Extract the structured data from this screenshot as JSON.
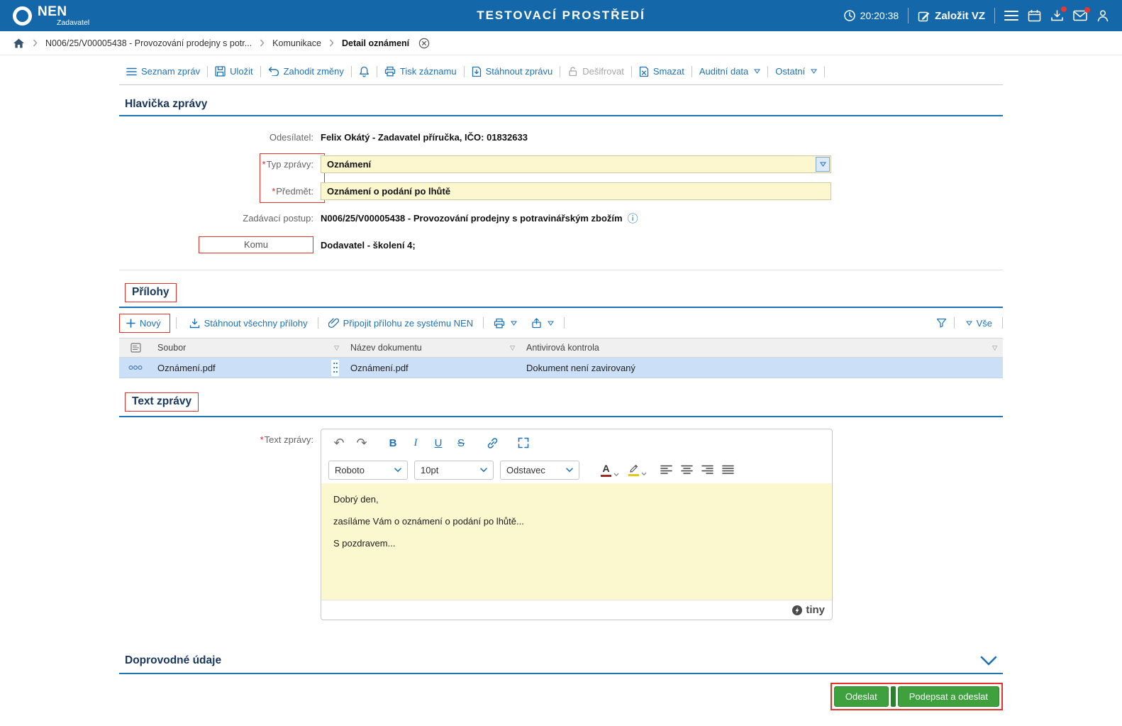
{
  "colors": {
    "header_bg": "#1467a8",
    "link_blue": "#1d72b8",
    "annotation_red": "#e5322a",
    "button_green": "#3ea13e",
    "input_yellow": "#fcf7cf",
    "selected_row": "#cbe0f7"
  },
  "header": {
    "brand": "NEN",
    "brand_sub": "Zadavatel",
    "env_title": "TESTOVACÍ PROSTŘEDÍ",
    "time": "20:20:38",
    "create_vz_label": "Založit VZ"
  },
  "breadcrumb": {
    "items": [
      {
        "label": "N006/25/V00005438 - Provozování prodejny s potr..."
      },
      {
        "label": "Komunikace"
      },
      {
        "label": "Detail oznámení"
      }
    ]
  },
  "toolbar": {
    "items": [
      {
        "label": "Seznam zpráv"
      },
      {
        "label": "Uložit"
      },
      {
        "label": "Zahodit změny"
      },
      {
        "label": "Tisk záznamu"
      },
      {
        "label": "Stáhnout zprávu"
      },
      {
        "label": "Dešifrovat"
      },
      {
        "label": "Smazat"
      },
      {
        "label": "Auditní data"
      },
      {
        "label": "Ostatní"
      }
    ]
  },
  "message_header": {
    "title": "Hlavička zprávy",
    "sender_label": "Odesílatel:",
    "sender_value": "Felix Okátý - Zadavatel příručka, IČO: 01832633",
    "required_mark": "*",
    "type_label": "Typ zprávy:",
    "type_value": "Oznámení",
    "subject_label": "Předmět:",
    "subject_value": "Oznámení o podání po lhůtě",
    "procedure_label": "Zadávací postup:",
    "procedure_value": "N006/25/V00005438 - Provozování prodejny s potravinářským zbožím",
    "recipient_label": "Komu",
    "recipient_value": "Dodavatel - školení 4;"
  },
  "attachments": {
    "title": "Přílohy",
    "toolbar": {
      "new_label": "Nový",
      "download_all_label": "Stáhnout všechny přílohy",
      "attach_from_nen_label": "Připojit přílohu ze systému NEN",
      "all_filter_label": "Vše"
    },
    "columns": [
      {
        "label": "Soubor"
      },
      {
        "label": "Název dokumentu"
      },
      {
        "label": "Antivirová kontrola"
      }
    ],
    "rows": [
      {
        "file": "Oznámení.pdf",
        "document_name": "Oznámení.pdf",
        "antivirus": "Dokument není zavirovaný"
      }
    ]
  },
  "message_text": {
    "title": "Text zprávy",
    "field_label": "Text zprávy:",
    "editor": {
      "bold": "B",
      "italic": "I",
      "underline": "U",
      "strikethrough": "S",
      "font_family": "Roboto",
      "font_size": "10pt",
      "block_format": "Odstavec",
      "color_letter": "A",
      "content_lines": [
        "Dobrý den,",
        "zasíláme Vám o oznámení o podání po lhůtě...",
        "S pozdravem..."
      ],
      "brand": "tiny"
    }
  },
  "additional_section": {
    "title": "Doprovodné údaje"
  },
  "footer": {
    "send_label": "Odeslat",
    "sign_and_send_label": "Podepsat a odeslat"
  }
}
